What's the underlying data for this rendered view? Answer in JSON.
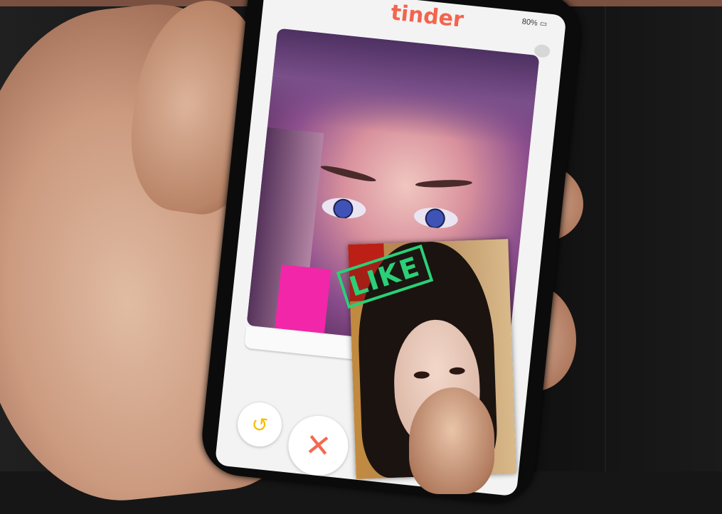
{
  "app": {
    "logo_text": "tinder",
    "status_bar": "80%",
    "brand_color": "#f3644e"
  },
  "like_stamp": {
    "label": "LIKE",
    "color": "#2bd077"
  },
  "icons": {
    "chat": "chat-bubbles-icon",
    "rewind": "rewind-icon",
    "dislike": "x-icon"
  }
}
